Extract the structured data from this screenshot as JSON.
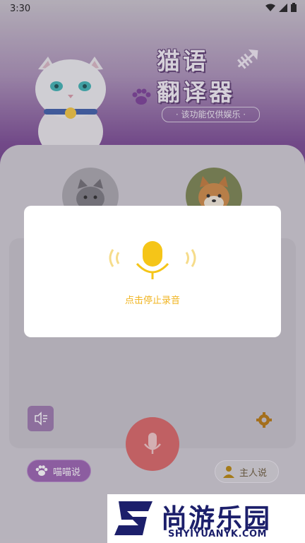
{
  "status_bar": {
    "time": "3:30"
  },
  "header": {
    "title_line1": "猫语",
    "title_line2": "翻译器",
    "subtitle": "· 该功能仅供娱乐 ·"
  },
  "dialog": {
    "hint": "点击停止录音"
  },
  "bottom": {
    "cat_speak_label": "喵喵说",
    "owner_speak_label": "主人说"
  },
  "watermark": {
    "main": "尚游乐园",
    "sub": "SHYIYUANYK.COM"
  },
  "colors": {
    "accent_purple": "#9a62b0",
    "mic_yellow": "#f5c518",
    "record_red": "#d96666"
  }
}
